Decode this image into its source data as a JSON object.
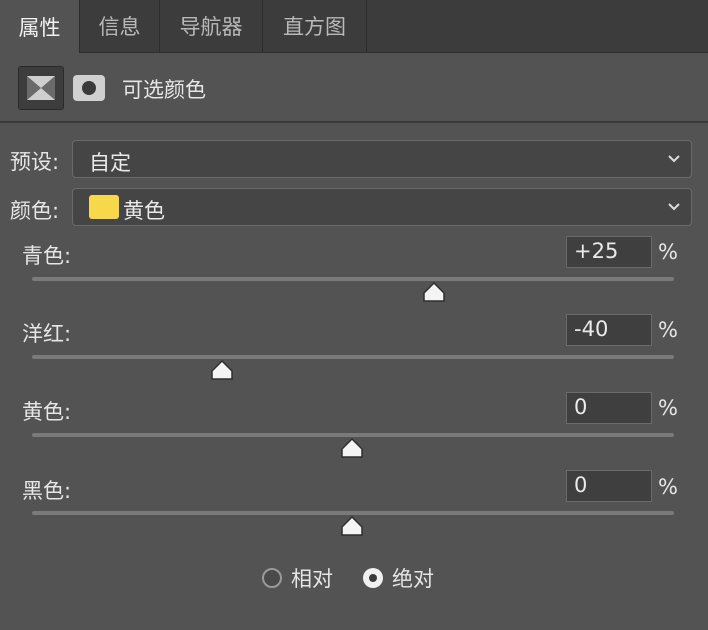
{
  "tabs": [
    {
      "label": "属性",
      "active": true
    },
    {
      "label": "信息"
    },
    {
      "label": "导航器"
    },
    {
      "label": "直方图"
    }
  ],
  "header": {
    "title": "可选颜色",
    "icons": [
      "adjustment-layer-icon",
      "layer-mask-icon"
    ]
  },
  "preset": {
    "label": "预设:",
    "value": "自定"
  },
  "colors": {
    "label": "颜色:",
    "value": "黄色",
    "swatch_color": "#f6d84a"
  },
  "sliders": [
    {
      "label": "青色:",
      "value": "+25",
      "unit": "%",
      "level": 25
    },
    {
      "label": "洋红:",
      "value": "-40",
      "unit": "%",
      "level": -40
    },
    {
      "label": "黄色:",
      "value": "0",
      "unit": "%",
      "level": 0
    },
    {
      "label": "黑色:",
      "value": "0",
      "unit": "%",
      "level": 0
    }
  ],
  "mode": {
    "options": [
      {
        "label": "相对",
        "selected": false
      },
      {
        "label": "绝对",
        "selected": true
      }
    ]
  }
}
